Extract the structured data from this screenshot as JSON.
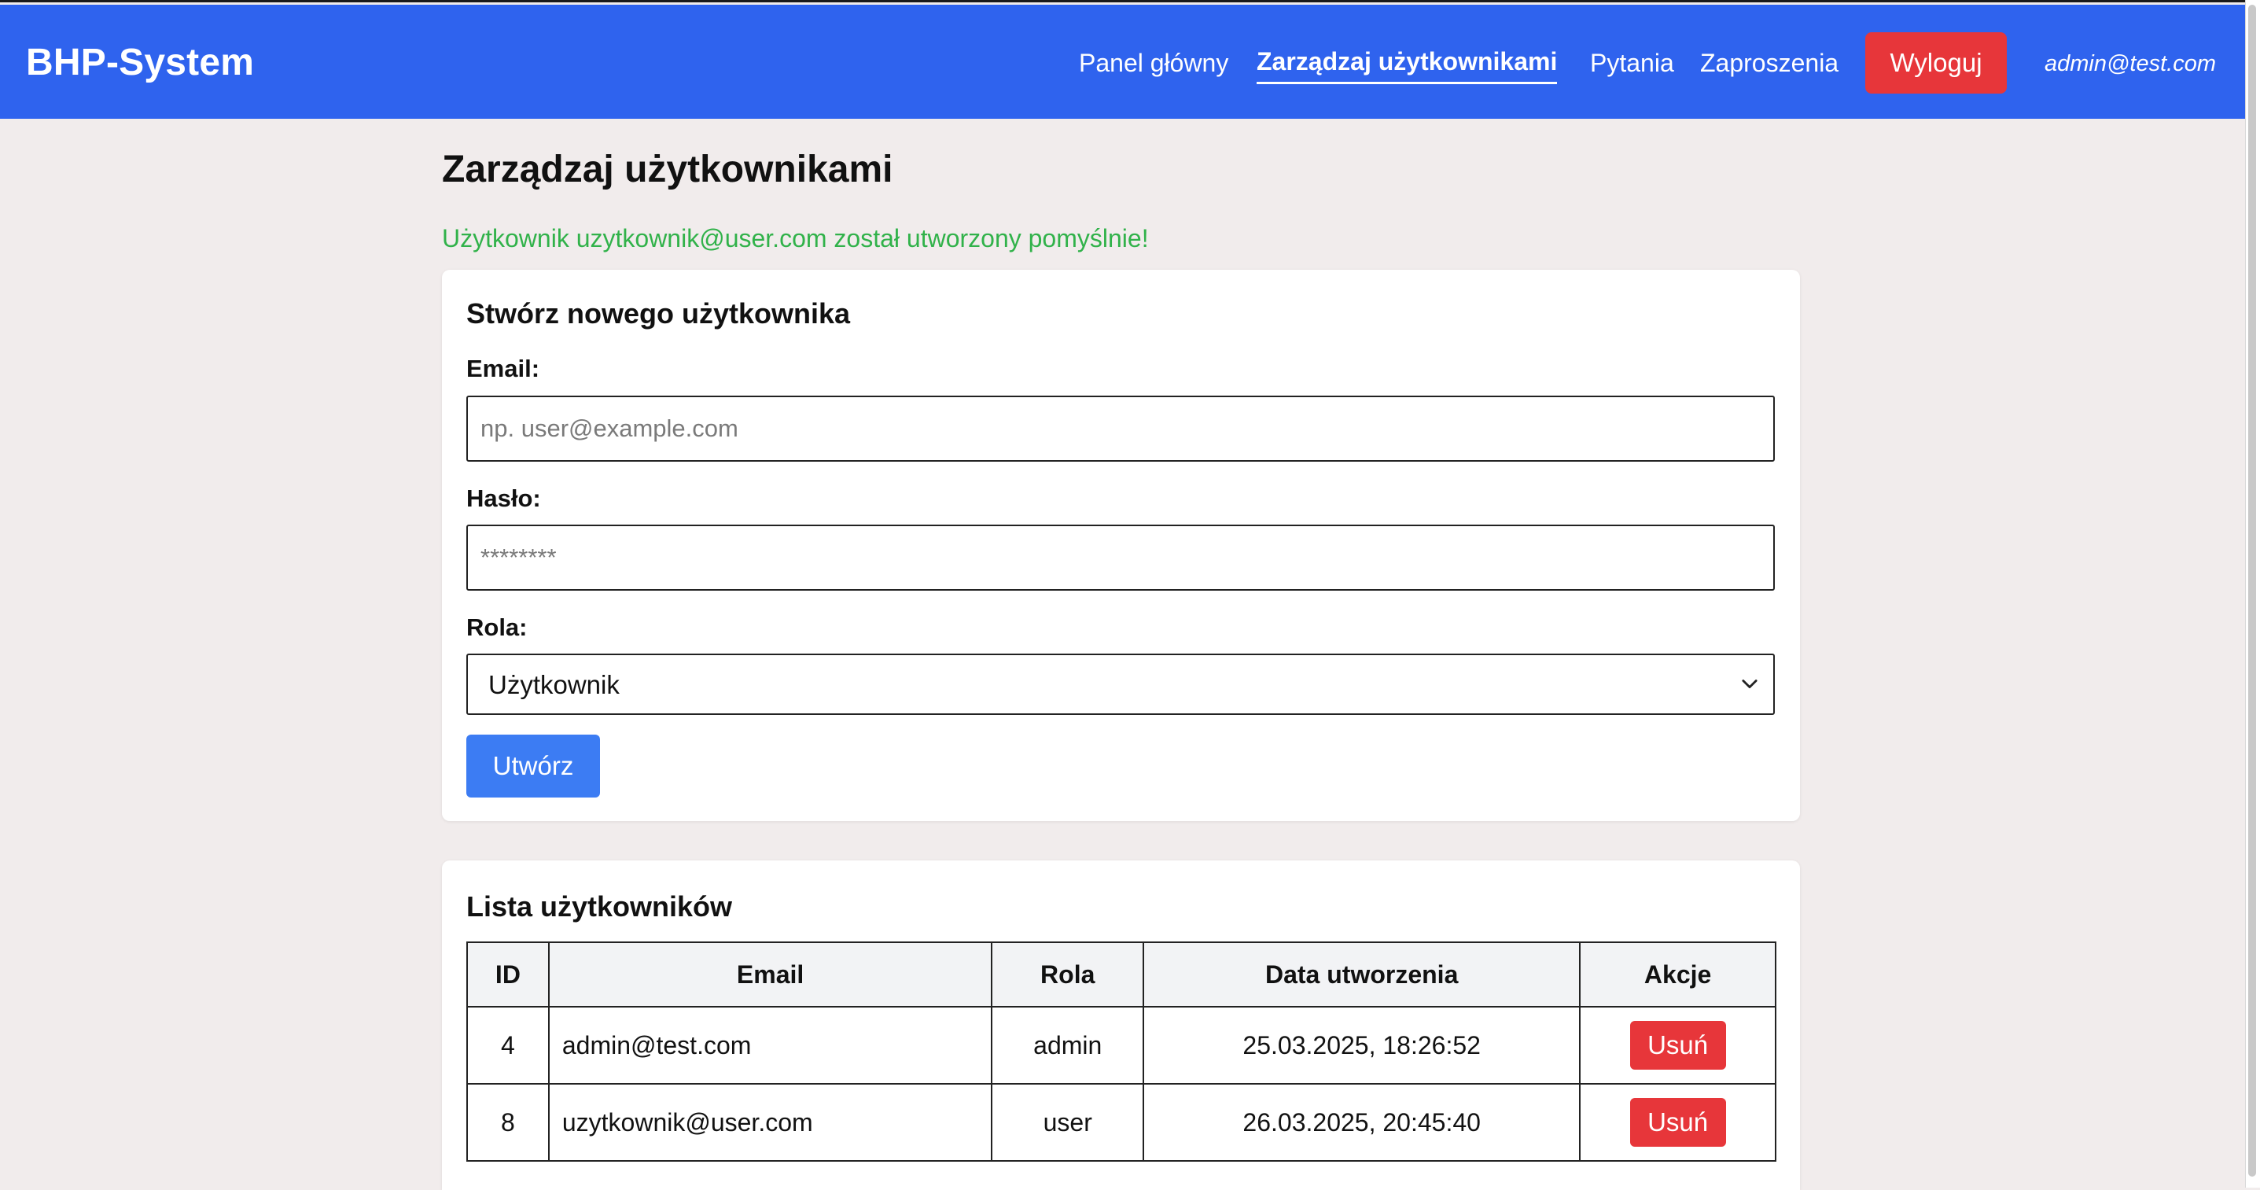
{
  "header": {
    "brand": "BHP-System",
    "nav": [
      {
        "label": "Panel główny",
        "active": false
      },
      {
        "label": "Zarządzaj użytkownikami",
        "active": true
      },
      {
        "label": "Pytania",
        "active": false
      },
      {
        "label": "Zaproszenia",
        "active": false
      }
    ],
    "logout_label": "Wyloguj",
    "user_email": "admin@test.com"
  },
  "page": {
    "title": "Zarządzaj użytkownikami",
    "success_message": "Użytkownik uzytkownik@user.com został utworzony pomyślnie!"
  },
  "create_form": {
    "title": "Stwórz nowego użytkownika",
    "email_label": "Email:",
    "email_placeholder": "np. user@example.com",
    "email_value": "",
    "password_label": "Hasło:",
    "password_placeholder": "********",
    "password_value": "",
    "role_label": "Rola:",
    "role_selected": "Użytkownik",
    "submit_label": "Utwórz"
  },
  "users_list": {
    "title": "Lista użytkowników",
    "columns": [
      "ID",
      "Email",
      "Rola",
      "Data utworzenia",
      "Akcje"
    ],
    "rows": [
      {
        "id": "4",
        "email": "admin@test.com",
        "role": "admin",
        "created": "25.03.2025, 18:26:52",
        "action": "Usuń"
      },
      {
        "id": "8",
        "email": "uzytkownik@user.com",
        "role": "user",
        "created": "26.03.2025, 20:45:40",
        "action": "Usuń"
      }
    ]
  },
  "colors": {
    "header_bg": "#2f63ee",
    "page_bg": "#f1ecec",
    "danger": "#e7363a",
    "primary_button": "#3c7cf3",
    "success_text": "#31b24a"
  },
  "icons": {
    "select_chevron": "chevron-down-icon"
  }
}
